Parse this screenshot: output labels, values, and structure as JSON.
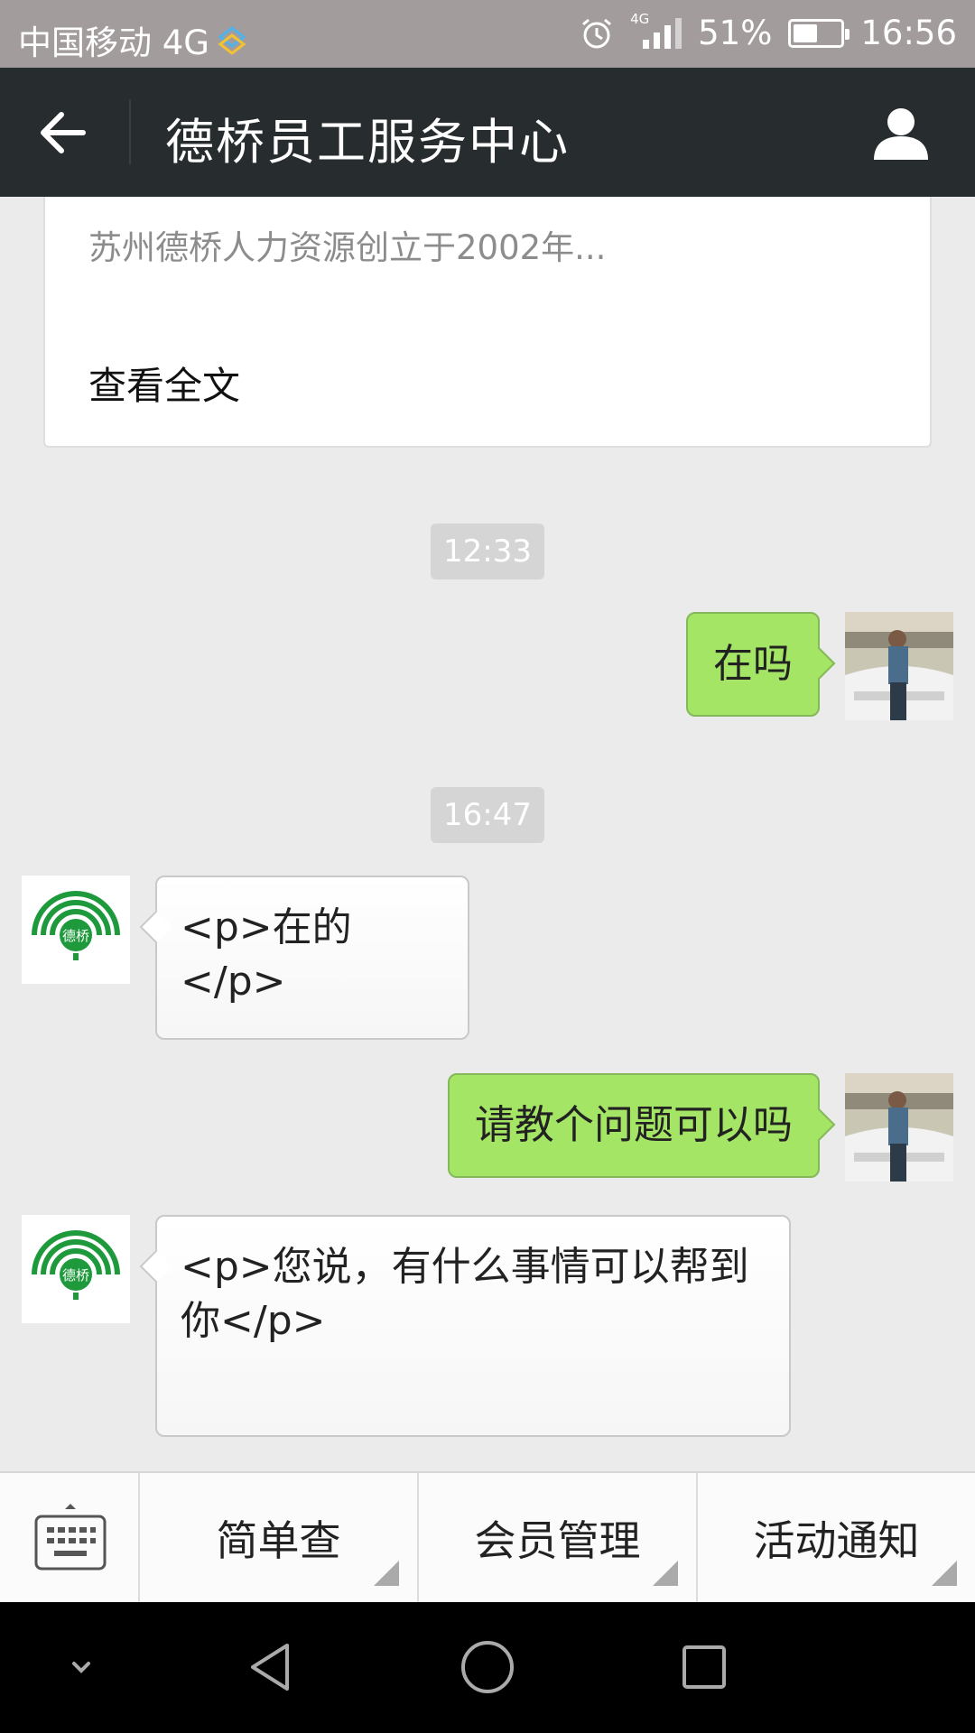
{
  "status_bar": {
    "carrier": "中国移动 4G",
    "network_badge": "4G",
    "battery": "51%",
    "battery_level": 0.51,
    "time": "16:56"
  },
  "header": {
    "title": "德桥员工服务中心"
  },
  "article": {
    "summary": "苏州德桥人力资源创立于2002年...",
    "read_all": "查看全文"
  },
  "messages": [
    {
      "type": "time",
      "text": "12:33"
    },
    {
      "type": "out",
      "text": "在吗"
    },
    {
      "type": "time",
      "text": "16:47"
    },
    {
      "type": "in",
      "text": "<p>在的</p>"
    },
    {
      "type": "out",
      "text": "请教个问题可以吗"
    },
    {
      "type": "in",
      "text": "<p>您说，有什么事情可以帮到你</p>"
    }
  ],
  "bot_logo_text": "德桥",
  "menu": {
    "items": [
      "简单查",
      "会员管理",
      "活动通知"
    ]
  },
  "colors": {
    "status_bar": "#a39c9d",
    "header": "#272c2e",
    "chat_bg": "#ebebeb",
    "out_bubble": "#a5e565",
    "in_bubble": "#ffffff",
    "brand_green": "#1e9a3c",
    "system_nav": "#000000"
  },
  "icons": [
    "network-icon",
    "alarm-icon",
    "signal-icon",
    "battery-icon",
    "back-arrow-icon",
    "profile-icon",
    "keyboard-icon",
    "collapse-icon",
    "back-triangle-icon",
    "home-circle-icon",
    "recents-square-icon"
  ]
}
